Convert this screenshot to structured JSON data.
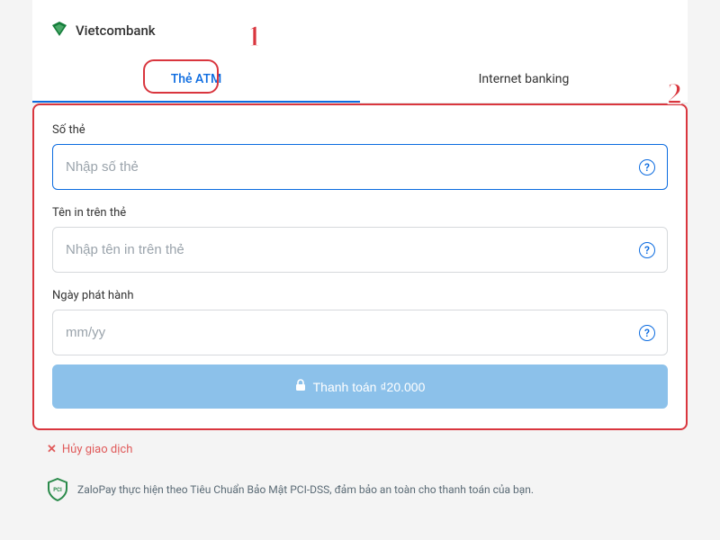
{
  "header": {
    "bank_name": "Vietcombank"
  },
  "tabs": {
    "atm": "Thẻ ATM",
    "ib": "Internet banking"
  },
  "form": {
    "card_number_label": "Số thẻ",
    "card_number_placeholder": "Nhập số thẻ",
    "card_name_label": "Tên in trên thẻ",
    "card_name_placeholder": "Nhập tên in trên thẻ",
    "issue_date_label": "Ngày phát hành",
    "issue_date_placeholder": "mm/yy",
    "pay_button_label": "Thanh toán ₫20.000"
  },
  "cancel_label": "Hủy giao dịch",
  "security_text": "ZaloPay thực hiện theo Tiêu Chuẩn Bảo Mật PCI-DSS, đảm bảo an toàn cho thanh toán của bạn.",
  "callouts": {
    "one": "1",
    "two": "2"
  }
}
